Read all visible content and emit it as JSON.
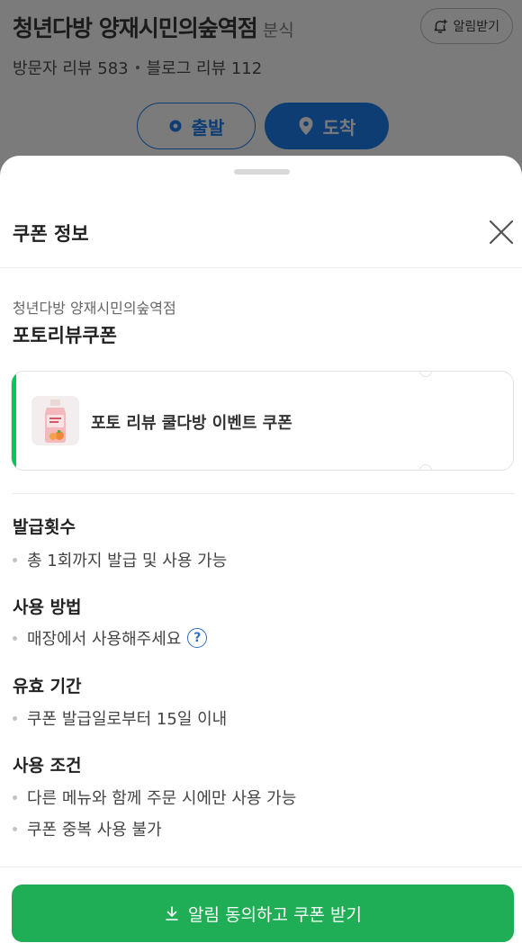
{
  "place": {
    "name": "청년다방 양재시민의숲역점",
    "category": "분식",
    "notify_label": "알림받기",
    "visitor_reviews": "방문자 리뷰 583",
    "blog_reviews": "블로그 리뷰 112",
    "start_label": "출발",
    "arrive_label": "도착",
    "route_color": "#0d3d73"
  },
  "sheet": {
    "title": "쿠폰 정보",
    "store_name": "청년다방 양재시민의숲역점",
    "coupon_name": "포토리뷰쿠폰",
    "coupon_card_text": "포토 리뷰 쿨다방 이벤트 쿠폰",
    "accent_color": "#03c75a"
  },
  "sections": {
    "issue_count": {
      "title": "발급횟수",
      "items": [
        "총 1회까지 발급 및 사용 가능"
      ]
    },
    "usage": {
      "title": "사용 방법",
      "items": [
        "매장에서 사용해주세요"
      ]
    },
    "validity": {
      "title": "유효 기간",
      "items": [
        "쿠폰 발급일로부터 15일 이내"
      ]
    },
    "conditions": {
      "title": "사용 조건",
      "items": [
        "다른 메뉴와 함께 주문 시에만 사용 가능",
        "쿠폰 중복 사용 불가"
      ]
    }
  },
  "cta": {
    "label": "알림 동의하고 쿠폰 받기",
    "color": "#1fae55"
  },
  "icons": {
    "notify": "bell-plus-icon",
    "start": "start-point-icon",
    "arrive": "location-pin-icon",
    "close": "close-icon",
    "help": "question-circle-icon",
    "download": "download-icon"
  }
}
